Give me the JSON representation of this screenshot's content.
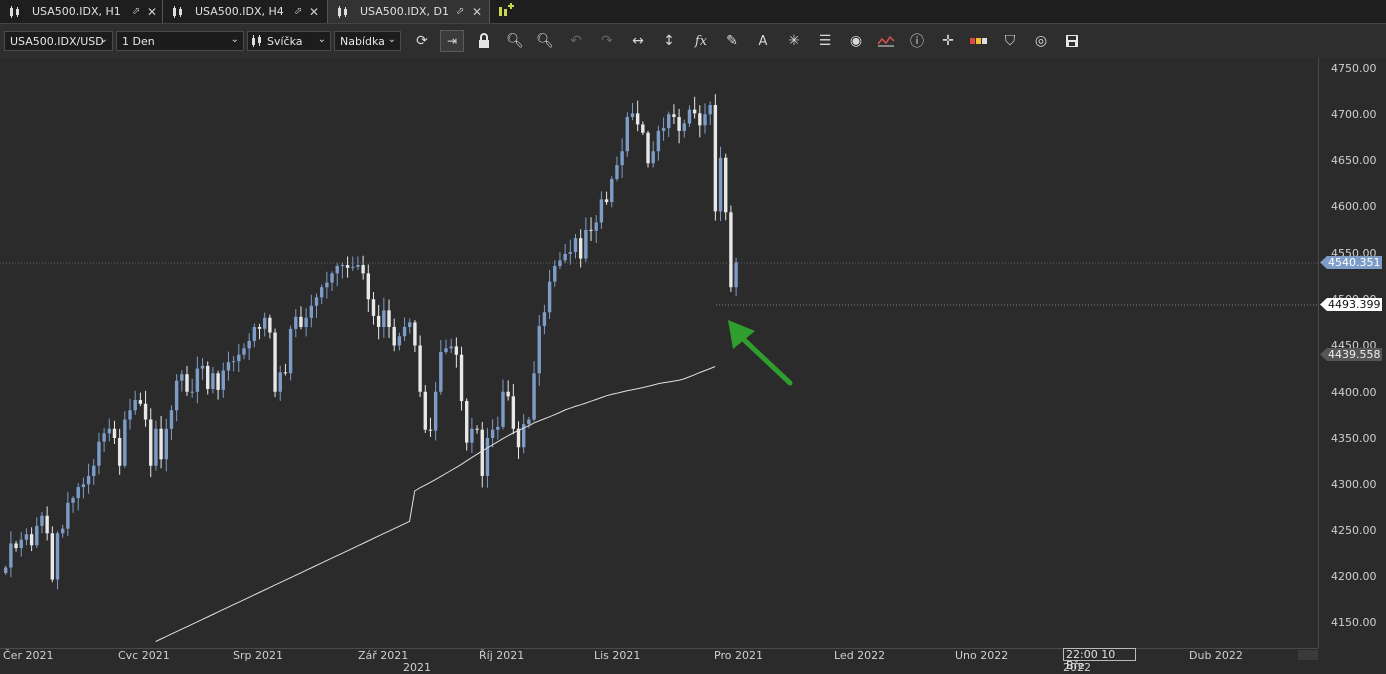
{
  "tabs": [
    {
      "label": "USA500.IDX, H1",
      "active": false
    },
    {
      "label": "USA500.IDX, H4",
      "active": false
    },
    {
      "label": "USA500.IDX, D1",
      "active": true
    }
  ],
  "toolbar": {
    "instrument": "USA500.IDX/USD",
    "period": "1 Den",
    "chart_type": "Svíčka",
    "offer_side": "Nabídka",
    "icons": [
      "refresh-icon",
      "auto-shift-icon",
      "lock-icon",
      "zoom-in-icon",
      "zoom-out-icon",
      "undo-icon",
      "redo-icon",
      "horizontal-stretch-icon",
      "vertical-stretch-icon",
      "function-icon",
      "pencil-icon",
      "text-icon",
      "crosshair-multi-icon",
      "layers-icon",
      "eye-icon",
      "indicator-icon",
      "info-icon",
      "crosshair-icon",
      "color-bars-icon",
      "paint-bucket-icon",
      "circle-icon",
      "save-icon"
    ]
  },
  "chart_data": {
    "type": "candlestick",
    "instrument": "USA500.IDX",
    "timeframe": "D1",
    "ylim": [
      4125,
      4770
    ],
    "yticks": [
      "4750.00",
      "4700.00",
      "4650.00",
      "4600.00",
      "4550.00",
      "4500.00",
      "4450.00",
      "4400.00",
      "4350.00",
      "4300.00",
      "4250.00",
      "4200.00",
      "4150.00"
    ],
    "xlabels": [
      "Čer 2021",
      "Cvc 2021",
      "Srp 2021",
      "Zář 2021",
      "Říj 2021",
      "Lis 2021",
      "Pro 2021",
      "Led 2022",
      "Uno 2022",
      "22:00 10 Bře",
      "Dub 2022"
    ],
    "year_labels": [
      "2021",
      "2022"
    ],
    "price_badges": [
      {
        "value": "4540.351",
        "color": "#7e9cc8"
      },
      {
        "value": "4493.399",
        "color": "#ffffff"
      },
      {
        "value": "4439.558",
        "color": "#555555"
      }
    ],
    "bull_color": "#7e9cc8",
    "bear_color": "#e8e8e8",
    "moving_average_color": "#e0e0e0",
    "arrow_color": "#2f9e2f",
    "closes": [
      4210,
      4236,
      4231,
      4240,
      4246,
      4234,
      4255,
      4266,
      4247,
      4197,
      4247,
      4252,
      4280,
      4285,
      4297,
      4300,
      4309,
      4320,
      4346,
      4355,
      4360,
      4350,
      4320,
      4370,
      4380,
      4391,
      4387,
      4370,
      4320,
      4360,
      4327,
      4360,
      4380,
      4412,
      4419,
      4400,
      4400,
      4425,
      4428,
      4403,
      4420,
      4402,
      4423,
      4432,
      4433,
      4440,
      4447,
      4455,
      4470,
      4468,
      4480,
      4464,
      4400,
      4421,
      4420,
      4468,
      4481,
      4470,
      4480,
      4493,
      4502,
      4513,
      4518,
      4528,
      4536,
      4537,
      4534,
      4535,
      4537,
      4528,
      4500,
      4482,
      4470,
      4488,
      4470,
      4450,
      4460,
      4470,
      4475,
      4450,
      4400,
      4359,
      4358,
      4400,
      4443,
      4447,
      4449,
      4440,
      4390,
      4345,
      4360,
      4359,
      4309,
      4350,
      4359,
      4362,
      4400,
      4395,
      4360,
      4340,
      4365,
      4370,
      4420,
      4471,
      4486,
      4519,
      4536,
      4542,
      4549,
      4551,
      4566,
      4544,
      4575,
      4574,
      4583,
      4608,
      4605,
      4630,
      4645,
      4660,
      4697,
      4701,
      4689,
      4680,
      4647,
      4660,
      4682,
      4685,
      4700,
      4697,
      4682,
      4690,
      4705,
      4701,
      4688,
      4700,
      4710,
      4595,
      4653,
      4594,
      4513,
      4540
    ]
  }
}
